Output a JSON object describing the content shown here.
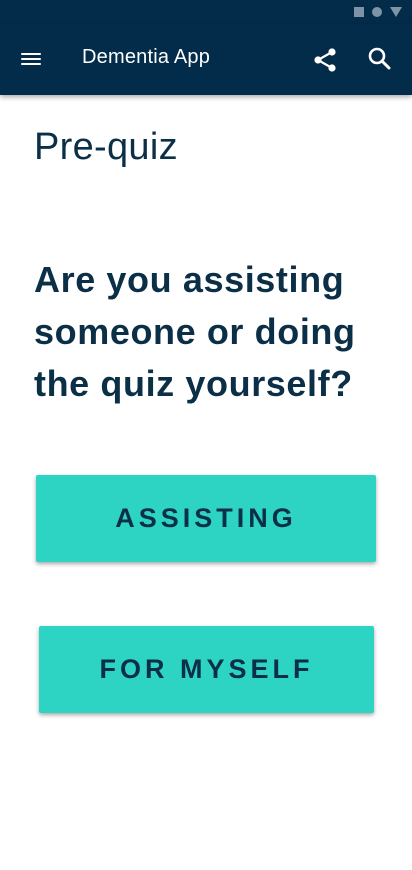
{
  "app_bar": {
    "title": "Dementia App",
    "menu_icon": "hamburger-menu-icon",
    "share_icon": "share-icon",
    "search_icon": "search-icon",
    "background": "#032c4a"
  },
  "page": {
    "title": "Pre-quiz",
    "question": "Are you assisting someone or doing the quiz yourself?"
  },
  "options": {
    "assisting_label": "ASSISTING",
    "myself_label": "FOR MYSELF",
    "button_color": "#2dd4c4",
    "text_color": "#0c2f48"
  }
}
